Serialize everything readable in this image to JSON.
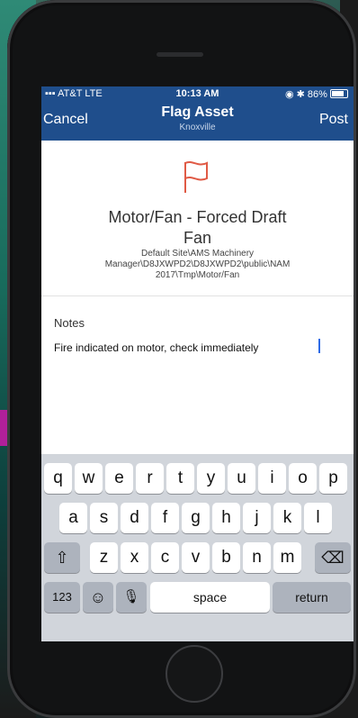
{
  "status_bar": {
    "carrier": "AT&T",
    "network": "LTE",
    "time": "10:13 AM",
    "battery": "86%"
  },
  "nav": {
    "cancel_label": "Cancel",
    "title": "Flag Asset",
    "subtitle": "Knoxville",
    "post_label": "Post"
  },
  "asset": {
    "icon": "flag-icon",
    "title_line1": "Motor/Fan - Forced Draft",
    "title_line2": "Fan",
    "path_line1": "Default Site\\AMS Machinery",
    "path_line2": "Manager\\D8JXWPD2\\D8JXWPD2\\public\\NAM",
    "path_line3": "2017\\Tmp\\Motor/Fan"
  },
  "notes": {
    "label": "Notes",
    "value": "Fire indicated on motor, check immediately"
  },
  "keyboard": {
    "row1": [
      "q",
      "w",
      "e",
      "r",
      "t",
      "y",
      "u",
      "i",
      "o",
      "p"
    ],
    "row2": [
      "a",
      "s",
      "d",
      "f",
      "g",
      "h",
      "j",
      "k",
      "l"
    ],
    "row3": [
      "z",
      "x",
      "c",
      "v",
      "b",
      "n",
      "m"
    ],
    "shift": "⇧",
    "delete": "⌫",
    "numbers": "123",
    "emoji": "☺",
    "mic": "🎙",
    "space": "space",
    "return": "return"
  },
  "colors": {
    "nav_bar": "#1f4e8c",
    "flag": "#e05a45",
    "caret": "#2e6be6"
  }
}
